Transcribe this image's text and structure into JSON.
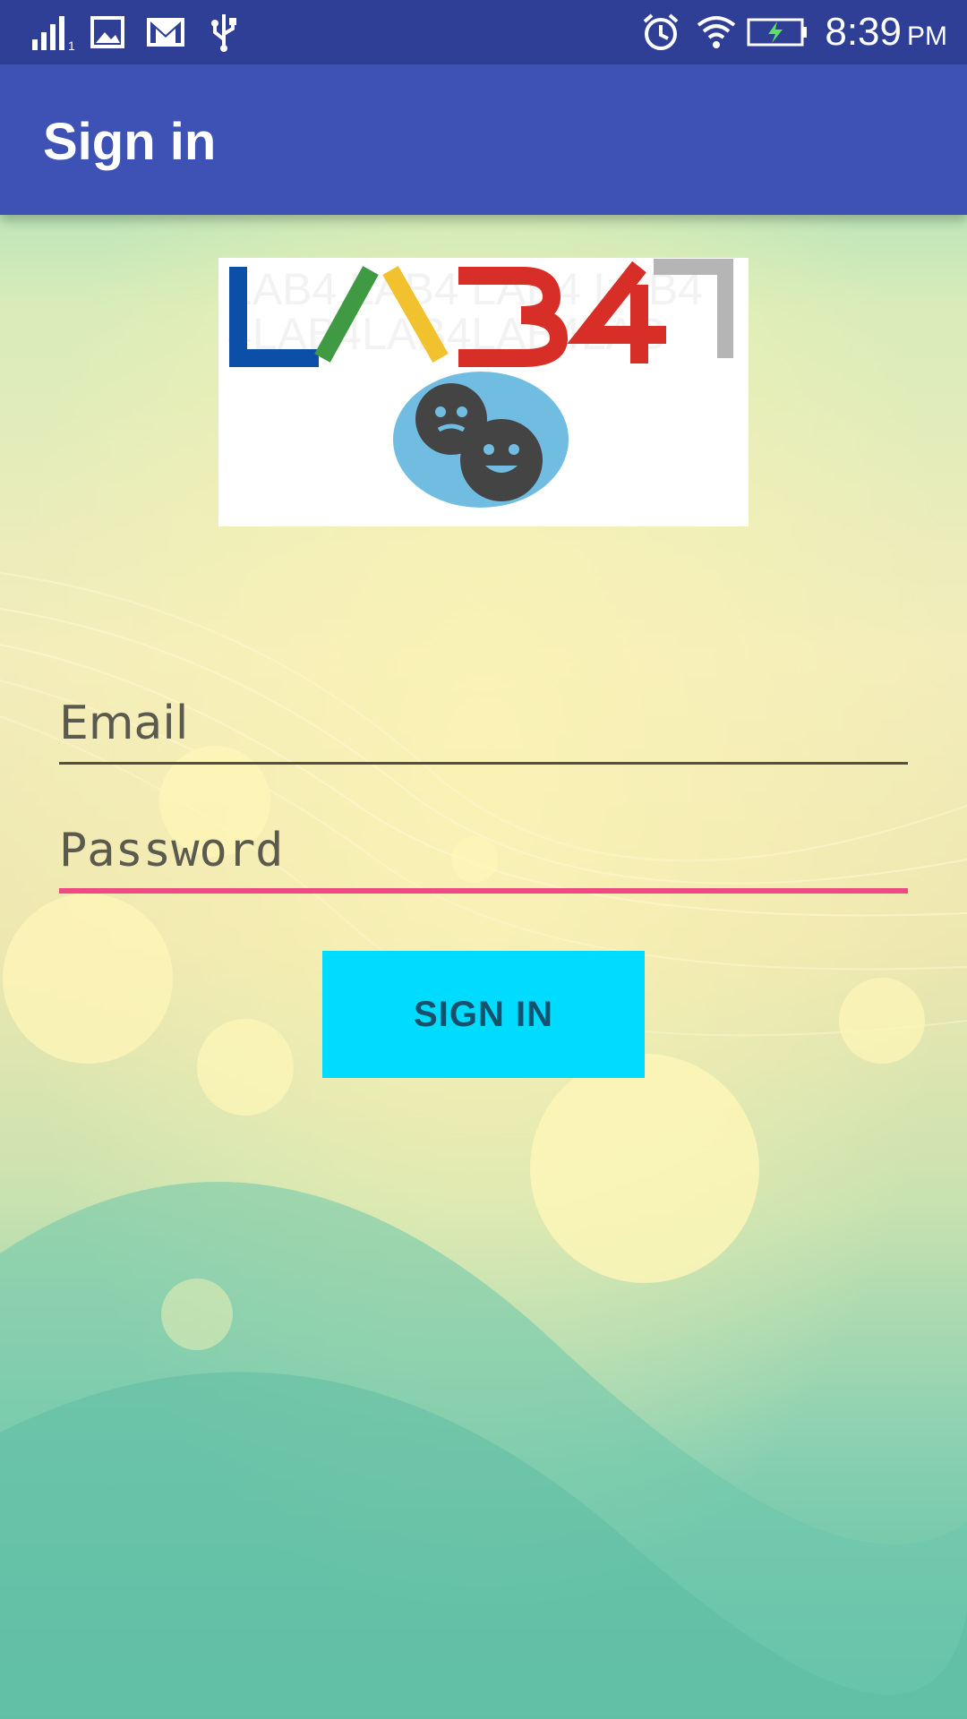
{
  "status_bar": {
    "time": "8:39",
    "ampm": "PM",
    "left_icons": [
      "signal-icon",
      "image-icon",
      "gmail-icon",
      "usb-icon"
    ],
    "right_icons": [
      "alarm-icon",
      "wifi-icon",
      "battery-charging-icon"
    ]
  },
  "app_bar": {
    "title": "Sign in"
  },
  "logo": {
    "text": "LAB4",
    "letter_colors": [
      "#0c4fa8",
      "#3f9a43",
      "#f2c12e",
      "#d72f27",
      "#b5b5b5"
    ]
  },
  "form": {
    "email_placeholder": "Email",
    "email_value": "",
    "password_placeholder": "Password",
    "password_value": "",
    "sign_in_label": "SIGN IN"
  },
  "colors": {
    "status_bar": "#2f3f96",
    "app_bar": "#3d52b4",
    "button": "#00dcff",
    "focus_underline": "#ef4a82"
  }
}
